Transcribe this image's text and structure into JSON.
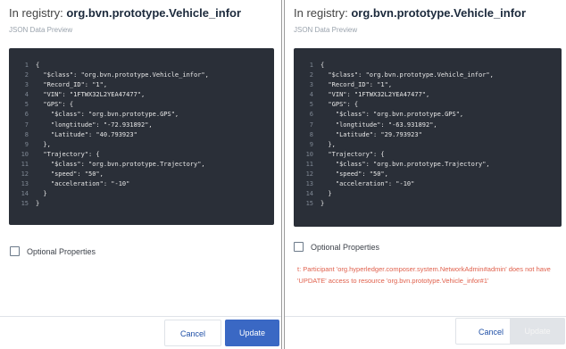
{
  "left_panel": {
    "title_prefix": "In registry:",
    "registry": "org.bvn.prototype.Vehicle_infor",
    "subtitle": "JSON Data Preview",
    "code": [
      {
        "n": "1",
        "t": "{"
      },
      {
        "n": "2",
        "t": "  \"$class\": \"org.bvn.prototype.Vehicle_infor\","
      },
      {
        "n": "3",
        "t": "  \"Record_ID\": \"1\","
      },
      {
        "n": "4",
        "t": "  \"VIN\": \"1FTWX32L2YEA47477\","
      },
      {
        "n": "5",
        "t": "  \"GPS\": {"
      },
      {
        "n": "6",
        "t": "    \"$class\": \"org.bvn.prototype.GPS\","
      },
      {
        "n": "7",
        "t": "    \"longtitude\": \"-72.931892\","
      },
      {
        "n": "8",
        "t": "    \"Latitude\": \"40.793923\""
      },
      {
        "n": "9",
        "t": "  },"
      },
      {
        "n": "10",
        "t": "  \"Trajectory\": {"
      },
      {
        "n": "11",
        "t": "    \"$class\": \"org.bvn.prototype.Trajectory\","
      },
      {
        "n": "12",
        "t": "    \"speed\": \"50\","
      },
      {
        "n": "13",
        "t": "    \"acceleration\": \"-10\""
      },
      {
        "n": "14",
        "t": "  }"
      },
      {
        "n": "15",
        "t": "}"
      }
    ],
    "optional_label": "Optional Properties",
    "cancel_label": "Cancel",
    "update_label": "Update"
  },
  "right_panel": {
    "title_prefix": "In registry:",
    "registry": "org.bvn.prototype.Vehicle_infor",
    "subtitle": "JSON Data Preview",
    "code": [
      {
        "n": "1",
        "t": "{"
      },
      {
        "n": "2",
        "t": "  \"$class\": \"org.bvn.prototype.Vehicle_infor\","
      },
      {
        "n": "3",
        "t": "  \"Record_ID\": \"1\","
      },
      {
        "n": "4",
        "t": "  \"VIN\": \"1FTWX32L2YEA47477\","
      },
      {
        "n": "5",
        "t": "  \"GPS\": {"
      },
      {
        "n": "6",
        "t": "    \"$class\": \"org.bvn.prototype.GPS\","
      },
      {
        "n": "7",
        "t": "    \"longtitude\": \"-63.931892\","
      },
      {
        "n": "8",
        "t": "    \"Latitude\": \"29.793923\""
      },
      {
        "n": "9",
        "t": "  },"
      },
      {
        "n": "10",
        "t": "  \"Trajectory\": {"
      },
      {
        "n": "11",
        "t": "    \"$class\": \"org.bvn.prototype.Trajectory\","
      },
      {
        "n": "12",
        "t": "    \"speed\": \"50\","
      },
      {
        "n": "13",
        "t": "    \"acceleration\": \"-10\""
      },
      {
        "n": "14",
        "t": "  }"
      },
      {
        "n": "15",
        "t": "}"
      }
    ],
    "optional_label": "Optional Properties",
    "error_message": "t: Participant 'org.hyperledger.composer.system.NetworkAdmin#admin' does not have 'UPDATE' access to resource 'org.bvn.prototype.Vehicle_infor#1'",
    "cancel_label": "Cancel",
    "update_label": "Update"
  },
  "colors": {
    "code_background": "#2a2f38",
    "primary_button": "#3a68c4",
    "disabled_button": "#e1e4e8",
    "error_text": "#e0614d",
    "link_text": "#1f4fa6"
  }
}
